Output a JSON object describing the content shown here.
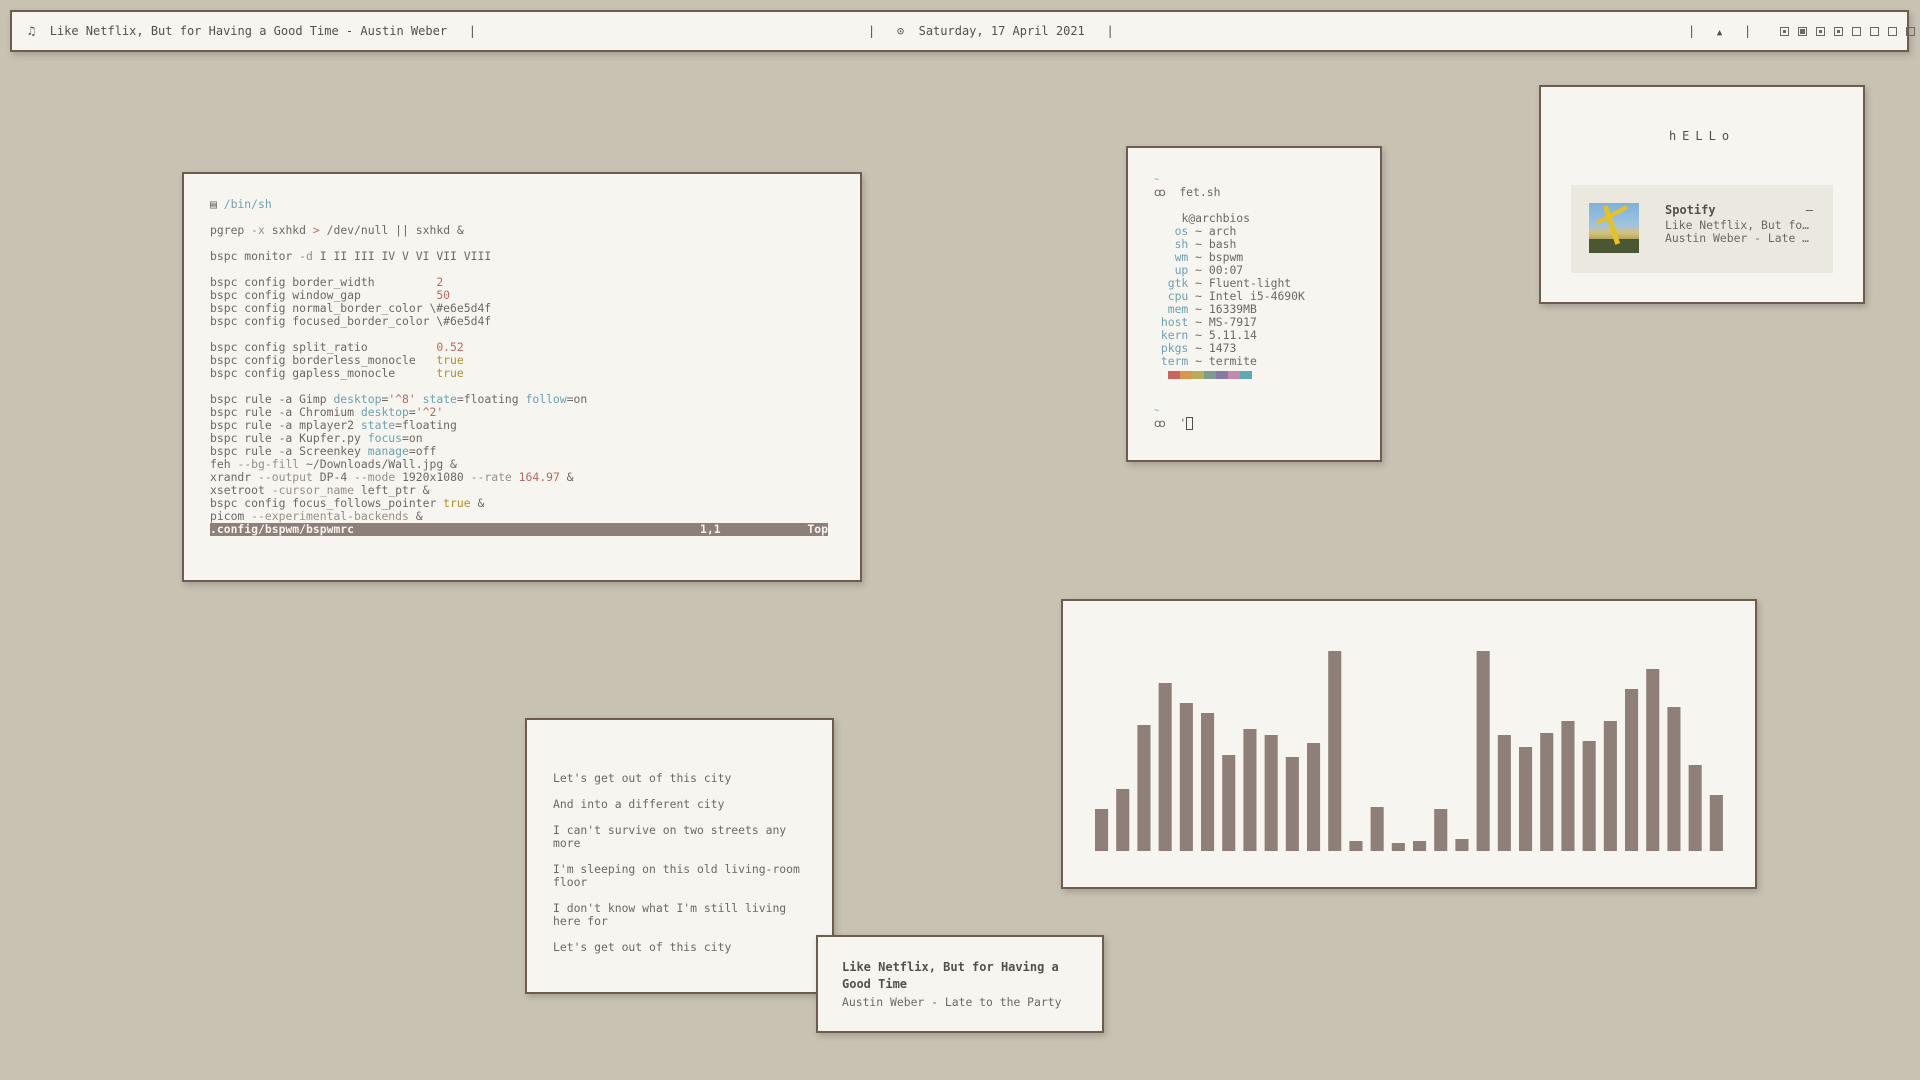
{
  "topbar": {
    "music_icon": "♫",
    "now_playing": "Like Netflix, But for Having a Good Time - Austin Weber",
    "clock_icon": "⊙",
    "date": "Saturday, 17 April 2021",
    "bell_icon": "▲",
    "separator": "|",
    "workspaces": [
      {
        "state": "occupied"
      },
      {
        "state": "active"
      },
      {
        "state": "occupied"
      },
      {
        "state": "occupied"
      },
      {
        "state": "empty"
      },
      {
        "state": "empty"
      },
      {
        "state": "empty"
      },
      {
        "state": "empty"
      }
    ]
  },
  "terminal": {
    "shebang_icon": "▤",
    "shebang": "/bin/sh",
    "lines": [
      [
        [
          "kw",
          "pgrep "
        ],
        [
          "flag",
          "-x "
        ],
        [
          "kw",
          "sxhkd "
        ],
        [
          "num",
          "> "
        ],
        [
          "kw",
          "/dev/null || sxhkd &"
        ]
      ],
      [],
      [
        [
          "kw",
          "bspc monitor "
        ],
        [
          "flag",
          "-d "
        ],
        [
          "kw",
          "I II III IV V VI VII VIII"
        ]
      ],
      [],
      [
        [
          "kw",
          "bspc config border_width         "
        ],
        [
          "num",
          "2"
        ]
      ],
      [
        [
          "kw",
          "bspc config window_gap           "
        ],
        [
          "num",
          "50"
        ]
      ],
      [
        [
          "kw",
          "bspc config normal_border_color \\#e6e5d4f"
        ]
      ],
      [
        [
          "kw",
          "bspc config focused_border_color \\#6e5d4f"
        ]
      ],
      [],
      [
        [
          "kw",
          "bspc config split_ratio          "
        ],
        [
          "num",
          "0.52"
        ]
      ],
      [
        [
          "kw",
          "bspc config borderless_monocle   "
        ],
        [
          "tru",
          "true"
        ]
      ],
      [
        [
          "kw",
          "bspc config gapless_monocle      "
        ],
        [
          "tru",
          "true"
        ]
      ],
      [],
      [
        [
          "kw",
          "bspc rule -a Gimp "
        ],
        [
          "opt",
          "desktop"
        ],
        [
          "kw",
          "="
        ],
        [
          "str",
          "'^8' "
        ],
        [
          "opt",
          "state"
        ],
        [
          "kw",
          "=floating "
        ],
        [
          "opt",
          "follow"
        ],
        [
          "kw",
          "=on"
        ]
      ],
      [
        [
          "kw",
          "bspc rule -a Chromium "
        ],
        [
          "opt",
          "desktop"
        ],
        [
          "kw",
          "="
        ],
        [
          "str",
          "'^2'"
        ]
      ],
      [
        [
          "kw",
          "bspc rule -a mplayer2 "
        ],
        [
          "opt",
          "state"
        ],
        [
          "kw",
          "=floating"
        ]
      ],
      [
        [
          "kw",
          "bspc rule -a Kupfer.py "
        ],
        [
          "opt",
          "focus"
        ],
        [
          "kw",
          "=on"
        ]
      ],
      [
        [
          "kw",
          "bspc rule -a Screenkey "
        ],
        [
          "opt",
          "manage"
        ],
        [
          "kw",
          "=off"
        ]
      ],
      [
        [
          "kw",
          "feh "
        ],
        [
          "flag",
          "--bg-fill "
        ],
        [
          "kw",
          "~/Downloads/Wall.jpg &"
        ]
      ],
      [
        [
          "kw",
          "xrandr "
        ],
        [
          "flag",
          "--output "
        ],
        [
          "kw",
          "DP-4 "
        ],
        [
          "flag",
          "--mode "
        ],
        [
          "kw",
          "1920x1080 "
        ],
        [
          "flag",
          "--rate "
        ],
        [
          "num",
          "164.97 "
        ],
        [
          "kw",
          "&"
        ]
      ],
      [
        [
          "kw",
          "xsetroot "
        ],
        [
          "flag",
          "-cursor_name "
        ],
        [
          "kw",
          "left_ptr &"
        ]
      ],
      [
        [
          "kw",
          "bspc config focus_follows_pointer "
        ],
        [
          "tru",
          "true "
        ],
        [
          "kw",
          "&"
        ]
      ],
      [
        [
          "kw",
          "picom "
        ],
        [
          "flag",
          "--experimental-backends "
        ],
        [
          "kw",
          "&"
        ]
      ]
    ],
    "status_file": ".config/bspwm/bspwmrc",
    "status_pos": "1,1",
    "status_scroll": "Top"
  },
  "fetch": {
    "tilde": "~",
    "prompt_icon": "ꝏ",
    "command": "fet.sh",
    "user_host": "k@archbios",
    "rows": [
      {
        "label": "os",
        "value": "arch"
      },
      {
        "label": "sh",
        "value": "bash"
      },
      {
        "label": "wm",
        "value": "bspwm"
      },
      {
        "label": "up",
        "value": "00:07"
      },
      {
        "label": "gtk",
        "value": "Fluent-light"
      },
      {
        "label": "cpu",
        "value": "Intel i5-4690K"
      },
      {
        "label": "mem",
        "value": "16339MB"
      },
      {
        "label": "host",
        "value": "MS-7917"
      },
      {
        "label": "kern",
        "value": "5.11.14"
      },
      {
        "label": "pkgs",
        "value": "1473"
      },
      {
        "label": "term",
        "value": "termite"
      }
    ],
    "separator": "~",
    "palette": [
      "#c9645f",
      "#d9964f",
      "#b8ab5a",
      "#7c9c8c",
      "#8778a6",
      "#c488a8",
      "#5fa9b0"
    ],
    "tilde2": "~",
    "prompt_icon2": "ꝏ",
    "cursor_prefix": "'"
  },
  "hello": {
    "title": "hELLo",
    "player": {
      "app": "Spotify",
      "dash": "–",
      "song": "Like Netflix, But fo…",
      "artist": "Austin Weber - Late …"
    }
  },
  "visualizer": {
    "bar_color": "#8e7f78",
    "values": [
      0.21,
      0.31,
      0.63,
      0.84,
      0.74,
      0.69,
      0.48,
      0.61,
      0.58,
      0.47,
      0.54,
      1.0,
      0.05,
      0.22,
      0.04,
      0.05,
      0.21,
      0.06,
      1.0,
      0.58,
      0.52,
      0.59,
      0.65,
      0.55,
      0.65,
      0.81,
      0.91,
      0.72,
      0.43,
      0.28
    ]
  },
  "lyrics": {
    "lines": [
      "Let's get out of this city",
      "And  into a different city",
      "I  can't survive on two streets any more",
      "I'm sleeping on this old living-room floor",
      "I don't know what I'm still living here for",
      "Let's  get out of this city"
    ]
  },
  "notification": {
    "title": "Like Netflix, But for Having a Good Time",
    "body": "Austin Weber - Late to the Party"
  }
}
